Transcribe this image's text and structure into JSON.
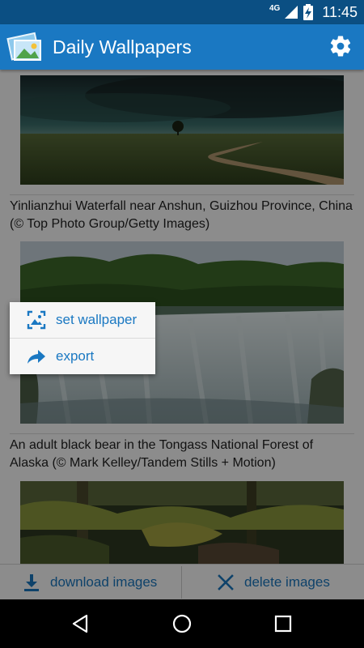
{
  "status_bar": {
    "network": "4G",
    "time": "11:45"
  },
  "app_bar": {
    "title": "Daily Wallpapers",
    "icon": "app-logo-icon",
    "settings_icon": "gear-icon"
  },
  "wallpapers": [
    {
      "caption": ""
    },
    {
      "caption": "Yinlianzhui Waterfall near Anshun, Guizhou Province, China (© Top Photo Group/Getty Images)"
    },
    {
      "caption": "An adult black bear in the Tongass National Forest of Alaska (© Mark Kelley/Tandem Stills + Motion)"
    }
  ],
  "context_menu": {
    "items": [
      {
        "label": "set wallpaper",
        "icon": "wallpaper-icon"
      },
      {
        "label": "export",
        "icon": "share-arrow-icon"
      }
    ]
  },
  "bottom_bar": {
    "download_label": "download images",
    "delete_label": "delete images"
  },
  "colors": {
    "accent": "#1a78c2",
    "app_bar": "#1a78c2",
    "status_bar": "#0b4f83"
  }
}
